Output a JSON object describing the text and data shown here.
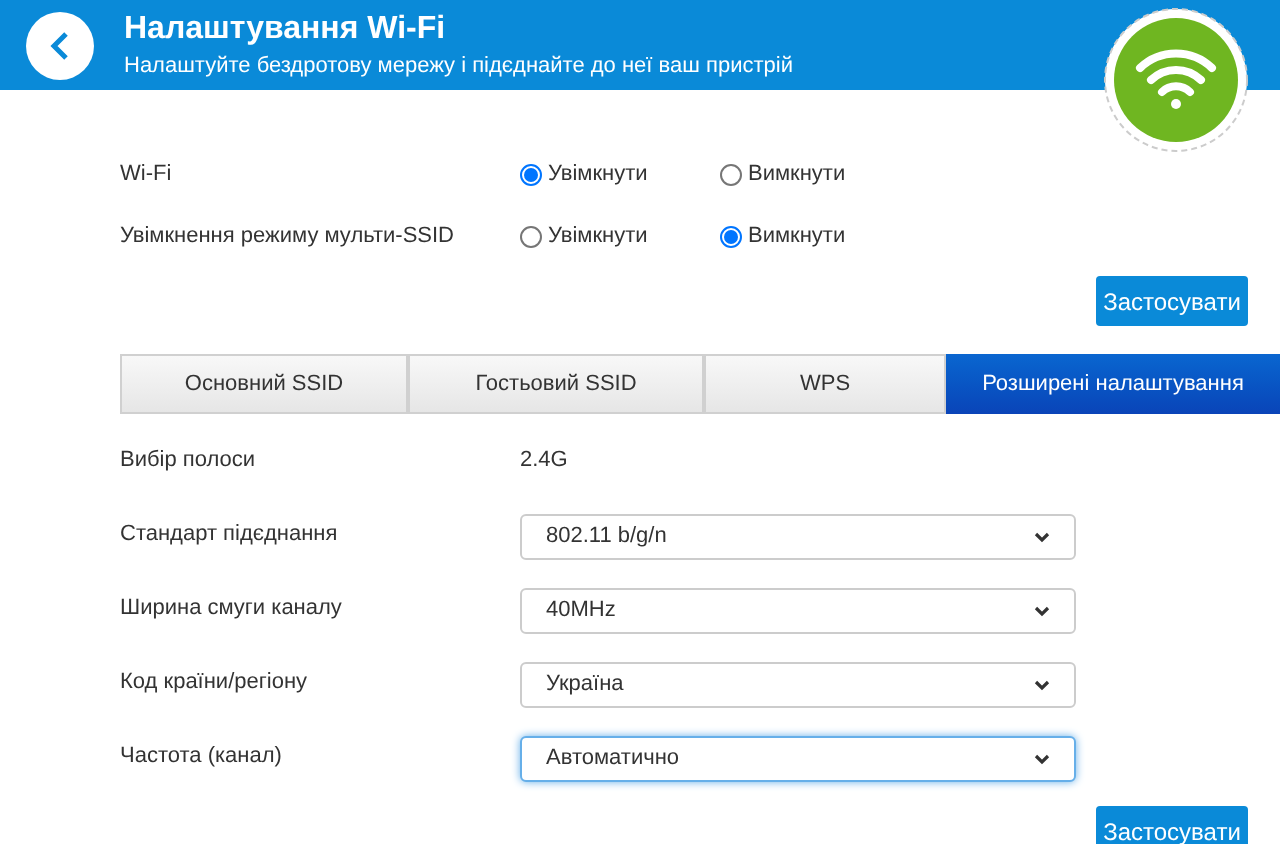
{
  "header": {
    "title": "Налаштування Wi-Fi",
    "subtitle": "Налаштуйте бездротову мережу і підєднайте до неї ваш пристрій"
  },
  "radio_rows": [
    {
      "label": "Wi-Fi",
      "options": [
        {
          "label": "Увімкнути",
          "selected": true
        },
        {
          "label": "Вимкнути",
          "selected": false
        }
      ]
    },
    {
      "label": "Увімкнення режиму мульти-SSID",
      "options": [
        {
          "label": "Увімкнути",
          "selected": false
        },
        {
          "label": "Вимкнути",
          "selected": true
        }
      ]
    }
  ],
  "apply_button_top": "Застосувати",
  "tabs": [
    {
      "label": "Основний SSID",
      "selected": false
    },
    {
      "label": "Гостьовий SSID",
      "selected": false
    },
    {
      "label": "WPS",
      "selected": false
    },
    {
      "label": "Розширені налаштування",
      "selected": true
    }
  ],
  "fields": [
    {
      "kind": "text",
      "label": "Вибір полоси",
      "value": "2.4G"
    },
    {
      "kind": "select",
      "label": "Стандарт підєднання",
      "value": "802.11 b/g/n",
      "focused": false
    },
    {
      "kind": "select",
      "label": "Ширина смуги каналу",
      "value": "40MHz",
      "focused": false
    },
    {
      "kind": "select",
      "label": "Код країни/регіону",
      "value": "Україна",
      "focused": false
    },
    {
      "kind": "select",
      "label": "Частота (канал)",
      "value": "Автоматично",
      "focused": true
    }
  ],
  "apply_button_bottom": "Застосувати"
}
